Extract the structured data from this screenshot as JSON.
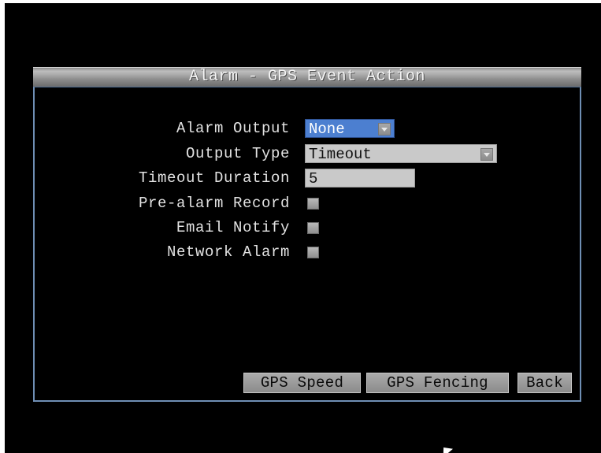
{
  "dialog": {
    "title": "Alarm - GPS Event Action"
  },
  "form": {
    "alarm_output": {
      "label": "Alarm Output",
      "value": "None",
      "icon": "chevron-down-icon"
    },
    "output_type": {
      "label": "Output Type",
      "value": "Timeout",
      "icon": "chevron-down-icon"
    },
    "timeout_duration": {
      "label": "Timeout Duration",
      "value": "5"
    },
    "pre_alarm_record": {
      "label": "Pre-alarm Record",
      "checked": false
    },
    "email_notify": {
      "label": "Email Notify",
      "checked": false
    },
    "network_alarm": {
      "label": "Network Alarm",
      "checked": false
    }
  },
  "buttons": {
    "gps_speed": "GPS Speed",
    "gps_fencing": "GPS Fencing",
    "back": "Back"
  },
  "colors": {
    "screen_background": "#000000",
    "selected_highlight": "#4c7fd0",
    "field_background": "#c9c9c9",
    "panel_border": "#6f8fb5",
    "label_text": "#e2e2e2"
  }
}
